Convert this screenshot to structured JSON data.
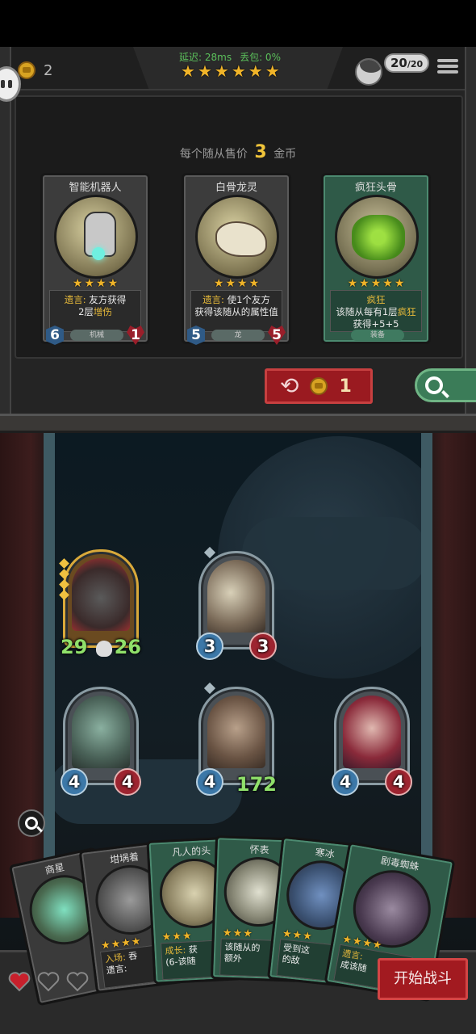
{
  "header": {
    "gold": "2",
    "latency_label": "延迟: 28ms",
    "packet_loss_label": "丢包: 0%",
    "tavern_stars": 6,
    "capacity": "20",
    "capacity_max": "/20"
  },
  "shop": {
    "price_prefix": "每个随从售价",
    "price_value": "3",
    "price_suffix": "金币",
    "cards": [
      {
        "name": "智能机器人",
        "stars": 4,
        "desc_keyword": "遗言:",
        "desc_text": " 友方获得",
        "desc_line2_prefix": "2层",
        "desc_line2_keyword": "增伤",
        "tag": "机械",
        "attack": "6",
        "health": "1",
        "type": "minion"
      },
      {
        "name": "白骨龙灵",
        "stars": 4,
        "desc_keyword": "遗言:",
        "desc_text": " 使1个友方",
        "desc_line2_prefix": "获得该随从的属性值",
        "desc_line2_keyword": "",
        "tag": "龙",
        "attack": "5",
        "health": "5",
        "type": "minion"
      },
      {
        "name": "疯狂头骨",
        "stars": 5,
        "desc_keyword": "疯狂",
        "desc_text": "",
        "desc_line2_prefix": "该随从每有1层",
        "desc_line2_keyword": "疯狂",
        "desc_line3": "获得+5+5",
        "tag": "装备",
        "attack": "",
        "health": "",
        "type": "equip"
      }
    ],
    "refresh_cost": "1"
  },
  "board": {
    "minions": [
      {
        "name": "flame-bear",
        "attack": "29",
        "health": "26",
        "style": "gold"
      },
      {
        "name": "armored-beast",
        "attack": "3",
        "health": "3",
        "style": "normal"
      },
      {
        "name": "horned-demon",
        "attack": "4",
        "health": "4",
        "style": "normal"
      },
      {
        "name": "brute",
        "attack": "4",
        "health": "172",
        "style": "normal"
      },
      {
        "name": "clown",
        "attack": "4",
        "health": "4",
        "style": "normal"
      }
    ]
  },
  "hand": {
    "cards": [
      {
        "name": "商星",
        "desc": "",
        "stars": 0,
        "type": "minion"
      },
      {
        "name": "坩埚着",
        "desc_keyword": "入场:",
        "desc": " 吞\n遗言:",
        "stars": 4,
        "type": "minion"
      },
      {
        "name": "凡人的头",
        "desc_keyword": "成长:",
        "desc": " 获\n(6-该随",
        "stars": 3,
        "type": "equip"
      },
      {
        "name": "怀表",
        "desc": "该随从的\n额外",
        "stars": 3,
        "type": "equip"
      },
      {
        "name": "寒冰",
        "desc": "受到这\n的敌",
        "stars": 3,
        "type": "equip"
      },
      {
        "name": "剧毒蜘蛛",
        "desc_keyword": "遗言:",
        "desc": "\n成该随",
        "stars": 4,
        "type": "equip"
      }
    ]
  },
  "lives": 3,
  "start_button": "开始战斗",
  "colors": {
    "gold": "#f0b429",
    "refresh_red": "#9a1a20",
    "search_green": "#3b7c58"
  }
}
